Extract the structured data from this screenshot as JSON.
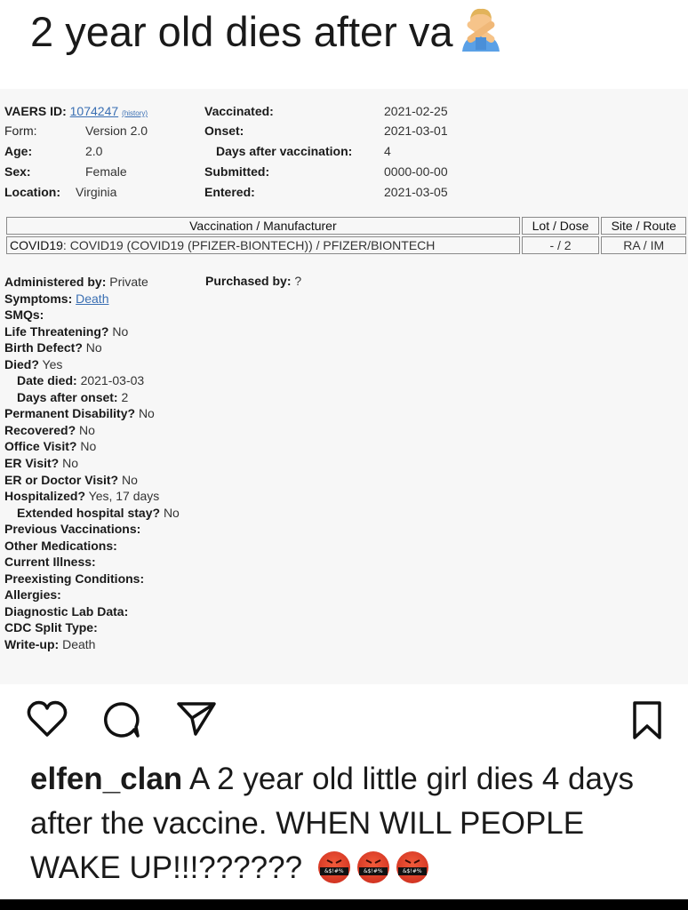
{
  "post": {
    "headline": "2 year old dies after va",
    "headline_emoji": "person-gesturing-no",
    "caption_user": "elfen_clan",
    "caption_text": "A 2 year old little girl dies 4 days after the vaccine. WHEN WILL PEOPLE WAKE UP!!!??????",
    "caption_emoji_label": "&$!#%",
    "caption_emoji_count": 3
  },
  "vaers": {
    "vaers_id_label": "VAERS ID:",
    "vaers_id": "1074247",
    "history_label": "(history)",
    "form_label": "Form:",
    "form": "Version 2.0",
    "age_label": "Age:",
    "age": "2.0",
    "sex_label": "Sex:",
    "sex": "Female",
    "location_label": "Location:",
    "location": "Virginia",
    "vaccinated_label": "Vaccinated:",
    "vaccinated": "2021-02-25",
    "onset_label": "Onset:",
    "onset": "2021-03-01",
    "days_after_vacc_label": "Days after vaccination:",
    "days_after_vacc": "4",
    "submitted_label": "Submitted:",
    "submitted": "0000-00-00",
    "entered_label": "Entered:",
    "entered": "2021-03-05"
  },
  "table": {
    "headers": [
      "Vaccination / Manufacturer",
      "Lot / Dose",
      "Site / Route"
    ],
    "row": {
      "code": "COVID19",
      "manufacturer": "COVID19 (COVID19 (PFIZER-BIONTECH)) / PFIZER/BIONTECH",
      "lot_dose": "- / 2",
      "site_route": "RA / IM"
    }
  },
  "details": {
    "administered_by_label": "Administered by:",
    "administered_by": "Private",
    "purchased_by_label": "Purchased by:",
    "purchased_by": "?",
    "symptoms_label": "Symptoms:",
    "symptoms": "Death",
    "smqs_label": "SMQs:",
    "life_threatening_label": "Life Threatening?",
    "life_threatening": "No",
    "birth_defect_label": "Birth Defect?",
    "birth_defect": "No",
    "died_label": "Died?",
    "died": "Yes",
    "date_died_label": "Date died:",
    "date_died": "2021-03-03",
    "days_after_onset_label": "Days after onset:",
    "days_after_onset": "2",
    "permanent_disability_label": "Permanent Disability?",
    "permanent_disability": "No",
    "recovered_label": "Recovered?",
    "recovered": "No",
    "office_visit_label": "Office Visit?",
    "office_visit": "No",
    "er_visit_label": "ER Visit?",
    "er_visit": "No",
    "er_doctor_label": "ER or Doctor Visit?",
    "er_doctor": "No",
    "hospitalized_label": "Hospitalized?",
    "hospitalized": "Yes, 17 days",
    "extended_stay_label": "Extended hospital stay?",
    "extended_stay": "No",
    "previous_vacc_label": "Previous Vaccinations:",
    "other_meds_label": "Other Medications:",
    "current_illness_label": "Current Illness:",
    "preexisting_label": "Preexisting Conditions:",
    "allergies_label": "Allergies:",
    "diag_lab_label": "Diagnostic Lab Data:",
    "cdc_split_label": "CDC Split Type:",
    "writeup_label": "Write-up:",
    "writeup": "Death"
  },
  "icons": {
    "like": "heart-icon",
    "comment": "comment-icon",
    "share": "send-icon",
    "save": "bookmark-icon"
  },
  "colors": {
    "link": "#3a6fb3",
    "emoji_red": "#e2452f"
  }
}
